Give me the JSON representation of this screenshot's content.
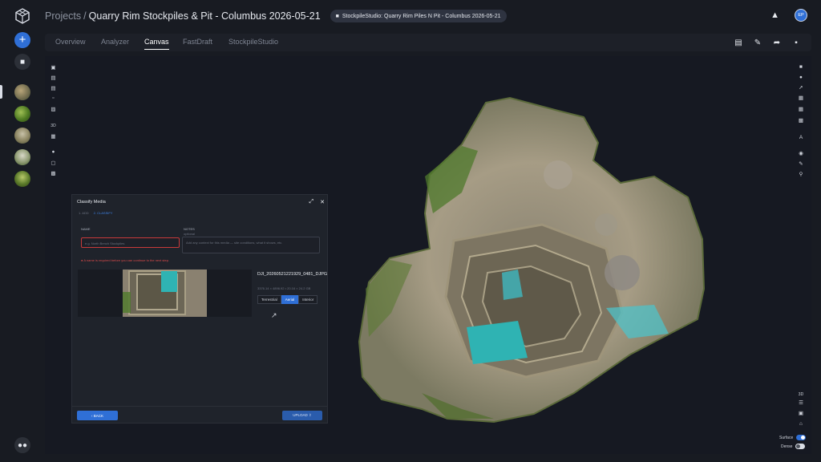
{
  "header": {
    "crumb_projects": "Projects",
    "crumb_sep": "/",
    "title": "Quarry Rim Stockpiles & Pit - Columbus 2026-05-21",
    "folder_pill": "StockpileStudio: Quarry Rim Piles N Pit - Columbus 2026-05-21",
    "avatar": "EP"
  },
  "tabs": [
    {
      "label": "Overview"
    },
    {
      "label": "Analyzer"
    },
    {
      "label": "Canvas"
    },
    {
      "label": "FastDraft"
    },
    {
      "label": "StockpileStudio"
    }
  ],
  "active_tab": "Canvas",
  "dialog": {
    "title": "Classify Media",
    "step1": "1. ADD",
    "step2": "2. CLASSIFY",
    "name_label": "NAME",
    "name_placeholder": "e.g. North Bench Stockpiles",
    "notes_label": "NOTES",
    "notes_sub": "optional",
    "notes_placeholder": "Add any context for this media — site conditions, what it shows, etc.",
    "error": "A name is required before you can continue to the next step.",
    "file_name": "DJI_20260521221929_0481_DJPG",
    "file_meta": "3376.14 × 4896.92 • 20.16 × 24.2 GB",
    "seg": [
      "Terrestrial",
      "Aerial",
      "Interior"
    ],
    "seg_selected": "Aerial",
    "back": "‹ BACK",
    "upload": "UPLOAD ⇪"
  },
  "toggles": [
    {
      "label": "Surface",
      "on": true
    },
    {
      "label": "Dense",
      "on": false
    }
  ],
  "right_label_3d": "3D",
  "left_label_3d": "3D",
  "colors": {
    "accent": "#2f6fd6",
    "error": "#d84a4a",
    "bg": "#181b22"
  }
}
